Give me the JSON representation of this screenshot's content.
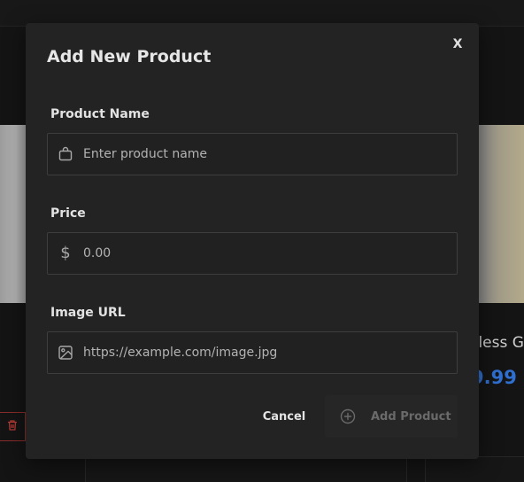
{
  "background": {
    "card_title_fragment": "eless G",
    "card_price_fragment": "9.99",
    "accent_price_color": "#2f6fd0",
    "delete_color": "#b23a34"
  },
  "modal": {
    "title": "Add New Product",
    "close_label": "X",
    "fields": {
      "name": {
        "label": "Product Name",
        "placeholder": "Enter product name",
        "icon": "shopping-bag-icon"
      },
      "price": {
        "label": "Price",
        "placeholder": "0.00",
        "icon": "dollar-icon"
      },
      "image": {
        "label": "Image URL",
        "placeholder": "https://example.com/image.jpg",
        "icon": "image-icon"
      }
    },
    "actions": {
      "cancel_label": "Cancel",
      "submit_label": "Add Product",
      "submit_icon": "plus-circle-icon",
      "submit_disabled": true
    }
  }
}
